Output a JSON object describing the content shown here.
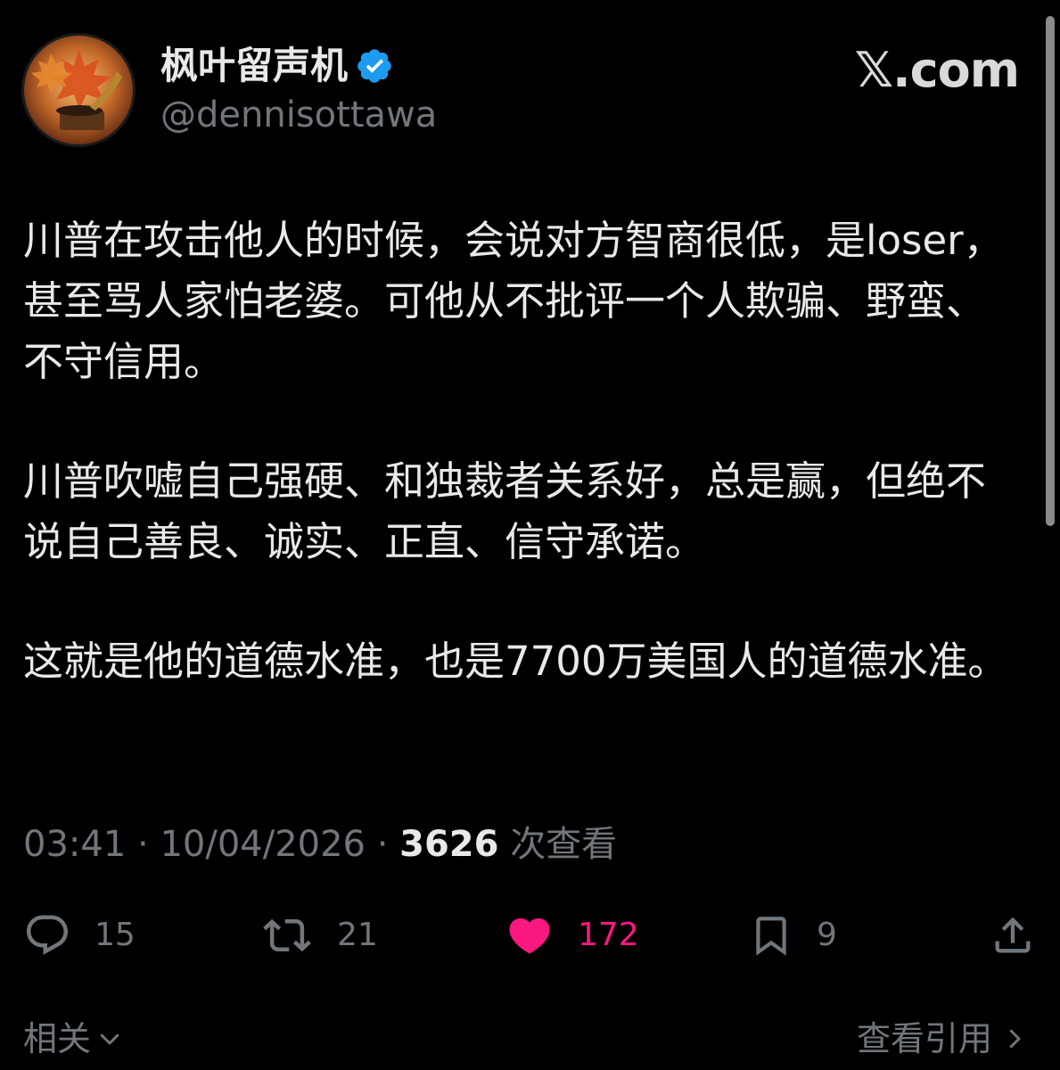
{
  "author": {
    "display_name": "枫叶留声机",
    "handle": "@dennisottawa",
    "verified": true,
    "avatar_icon": "maple-leaf-gramophone-avatar"
  },
  "brand": {
    "label": "𝕏.com"
  },
  "tweet": {
    "paragraphs": [
      "川普在攻击他人的时候，会说对方智商很低，是loser，甚至骂人家怕老婆。可他从不批评一个人欺骗、野蛮、不守信用。",
      "川普吹嘘自己强硬、和独裁者关系好，总是赢，但绝不说自己善良、诚实、正直、信守承诺。",
      "这就是他的道德水准，也是7700万美国人的道德水准。"
    ]
  },
  "meta": {
    "time": "03:41",
    "date": "10/04/2026",
    "separator": "·",
    "views_count": "3626",
    "views_label": "次查看"
  },
  "actions": {
    "reply": {
      "icon": "reply-bubble-icon",
      "count": "15"
    },
    "repost": {
      "icon": "repost-icon",
      "count": "21"
    },
    "like": {
      "icon": "heart-icon",
      "count": "172",
      "active": true
    },
    "bookmark": {
      "icon": "bookmark-icon",
      "count": "9"
    },
    "share": {
      "icon": "share-icon"
    }
  },
  "footer": {
    "related_label": "相关",
    "view_quotes_label": "查看引用"
  },
  "colors": {
    "background": "#000000",
    "text_primary": "#e7e9ea",
    "text_secondary": "#71767b",
    "like_active": "#f91880",
    "verified_badge": "#1d9bf0"
  }
}
